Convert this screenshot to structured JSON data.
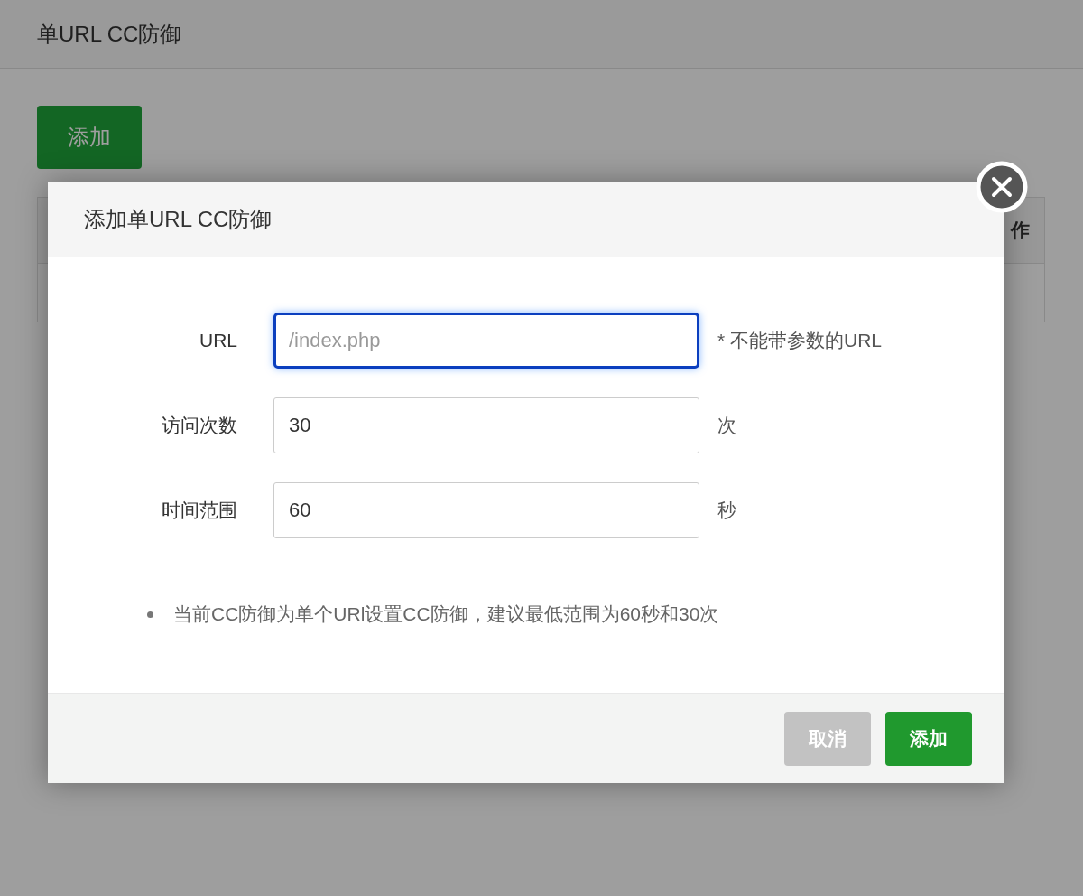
{
  "page": {
    "title": "单URL CC防御",
    "add_button": "添加",
    "table": {
      "columns": [
        {
          "label": "作"
        }
      ]
    }
  },
  "dialog": {
    "title": "添加单URL CC防御",
    "fields": [
      {
        "label": "URL",
        "placeholder": "/index.php",
        "focused": true,
        "hint": "* 不能带参数的URL"
      },
      {
        "label": "访问次数",
        "value": "30",
        "focused": false,
        "hint": "次"
      },
      {
        "label": "时间范围",
        "value": "60",
        "focused": false,
        "hint": "秒"
      }
    ],
    "notes": [
      "当前CC防御为单个URl设置CC防御，建议最低范围为60秒和30次"
    ],
    "buttons": [
      {
        "label": "取消",
        "kind": "secondary"
      },
      {
        "label": "添加",
        "kind": "primary"
      }
    ]
  }
}
